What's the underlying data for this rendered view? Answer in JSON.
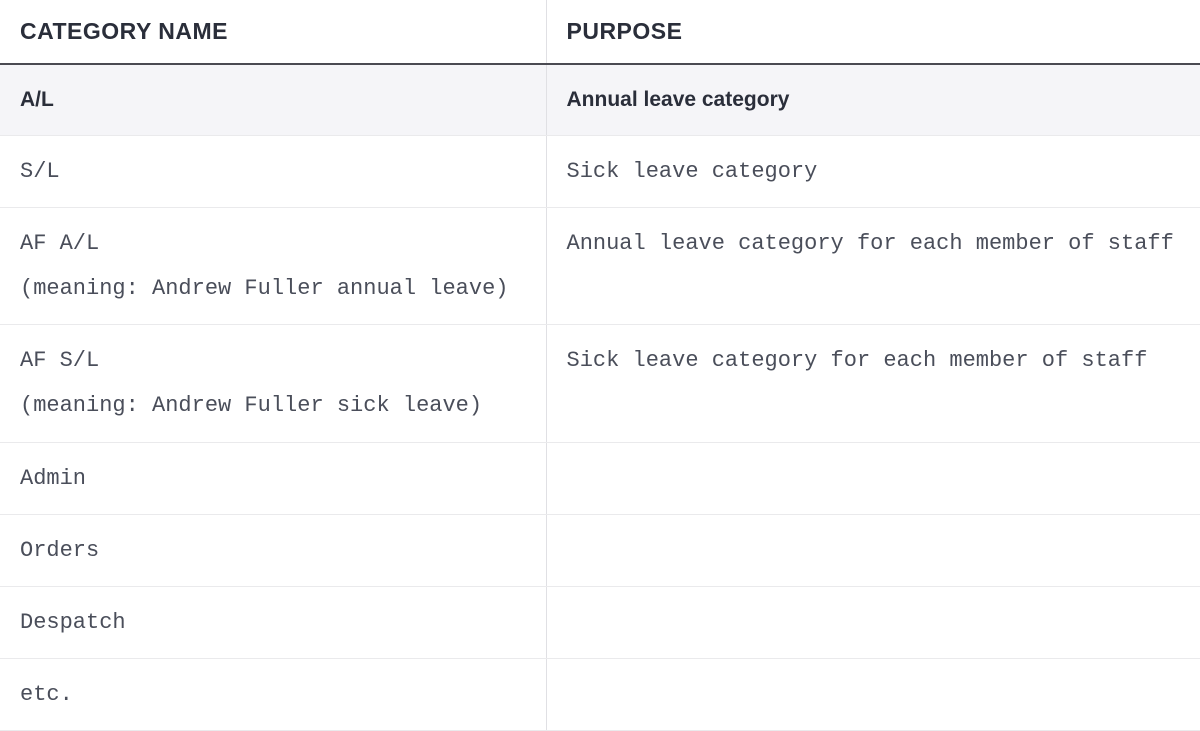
{
  "table": {
    "headers": {
      "category": "CATEGORY NAME",
      "purpose": "PURPOSE"
    },
    "rows": [
      {
        "category": "A/L",
        "sub": "",
        "purpose": "Annual leave category",
        "highlight": true
      },
      {
        "category": "S/L",
        "sub": "",
        "purpose": "Sick leave category",
        "highlight": false
      },
      {
        "category": "AF A/L",
        "sub": "(meaning: Andrew Fuller annual leave)",
        "purpose": "Annual leave category for each member of staff",
        "highlight": false
      },
      {
        "category": "AF S/L",
        "sub": "(meaning: Andrew Fuller sick leave)",
        "purpose": "Sick leave category for each member of staff",
        "highlight": false
      },
      {
        "category": "Admin",
        "sub": "",
        "purpose": "",
        "highlight": false
      },
      {
        "category": "Orders",
        "sub": "",
        "purpose": "",
        "highlight": false
      },
      {
        "category": "Despatch",
        "sub": "",
        "purpose": "",
        "highlight": false
      },
      {
        "category": "etc.",
        "sub": "",
        "purpose": "",
        "highlight": false
      }
    ]
  }
}
